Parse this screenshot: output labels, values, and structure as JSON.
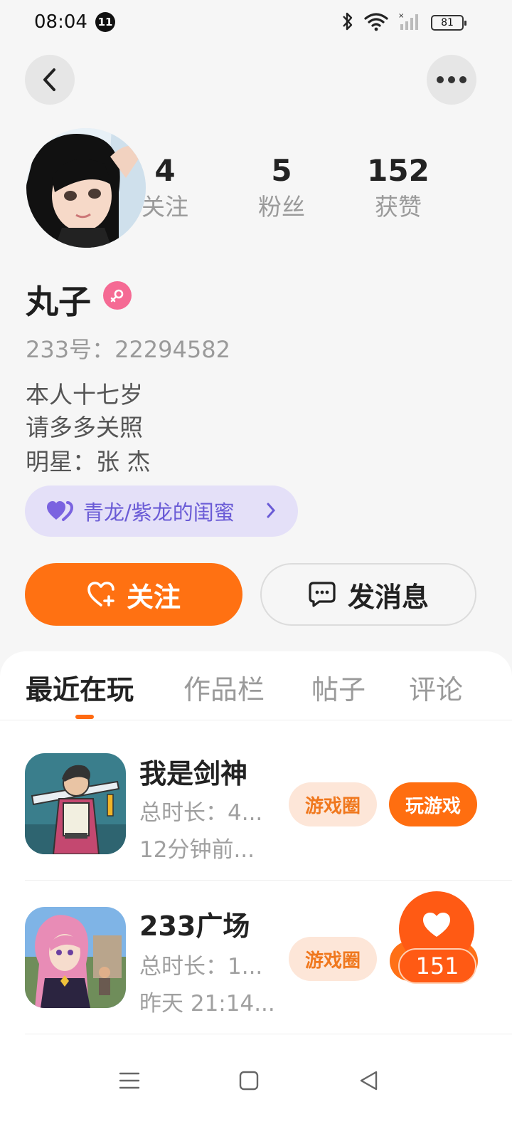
{
  "status_bar": {
    "time": "08:04",
    "notification_count": "11",
    "battery": "81",
    "icons": [
      "bluetooth-icon",
      "wifi-icon",
      "signal-icon",
      "battery-icon"
    ]
  },
  "header": {
    "back_icon": "chevron-left-icon",
    "more_icon": "more-dots-icon"
  },
  "profile": {
    "stats": [
      {
        "value": "4",
        "label": "关注"
      },
      {
        "value": "5",
        "label": "粉丝"
      },
      {
        "value": "152",
        "label": "获赞"
      }
    ],
    "nickname": "丸子",
    "gender": "female",
    "user_id": "233号：22294582",
    "bio": [
      "本人十七岁",
      "请多多关照",
      "明星：张 杰"
    ],
    "relation": "青龙/紫龙的闺蜜"
  },
  "actions": {
    "follow_label": "关注",
    "message_label": "发消息"
  },
  "tabs": [
    {
      "label": "最近在玩",
      "active": true
    },
    {
      "label": "作品栏",
      "active": false
    },
    {
      "label": "帖子",
      "active": false
    },
    {
      "label": "评论",
      "active": false
    }
  ],
  "games": [
    {
      "title": "我是剑神",
      "duration": "总时长：4...",
      "last_played": "12分钟前...",
      "circle_label": "游戏圈",
      "play_label": "玩游戏"
    },
    {
      "title": "233广场",
      "duration": "总时长：1...",
      "last_played": "昨天 21:14...",
      "circle_label": "游戏圈"
    }
  ],
  "like_bubble": {
    "count": "151"
  },
  "colors": {
    "accent": "#ff7112",
    "relation_bg": "#e4e0f8",
    "relation_text": "#6a5bd6",
    "gender_female": "#f56a94"
  }
}
